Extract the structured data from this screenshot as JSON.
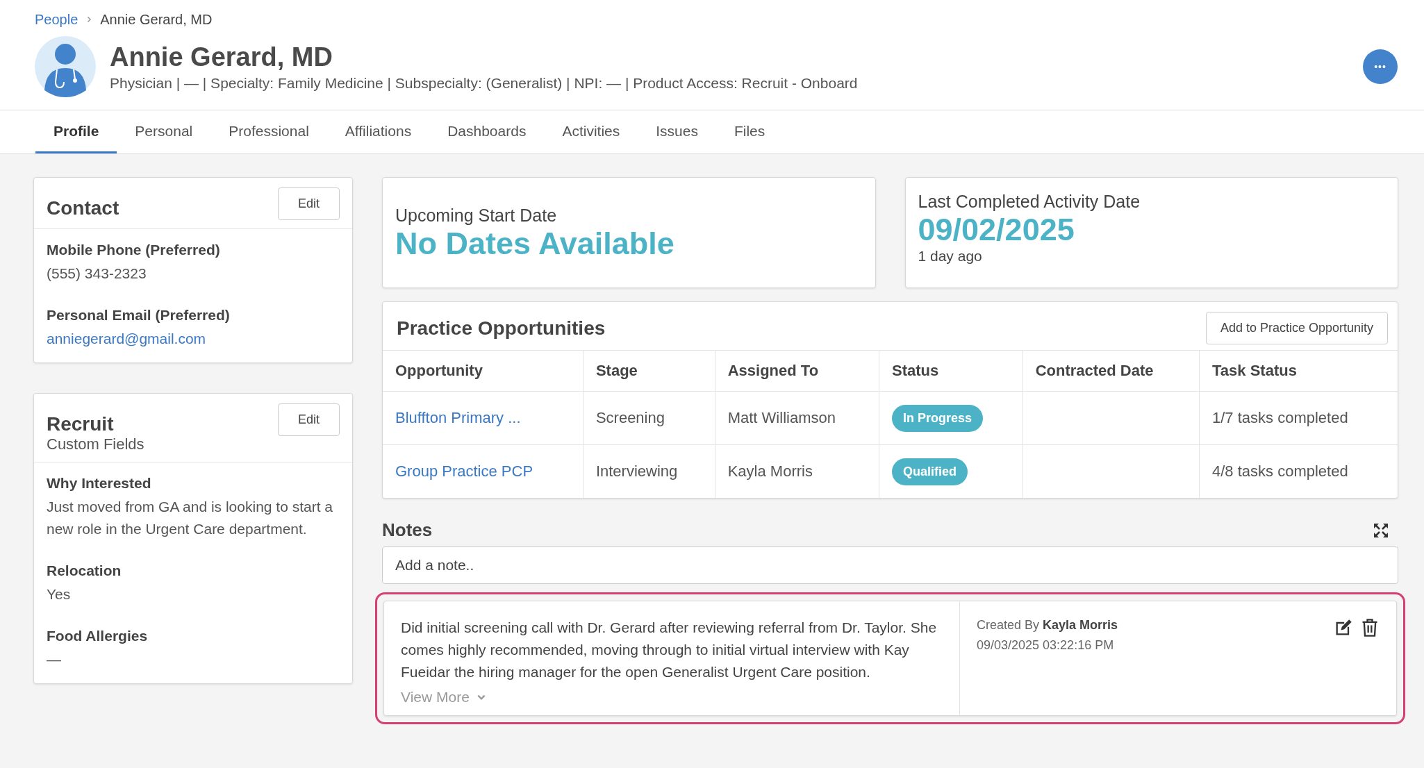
{
  "breadcrumb": {
    "parent": "People",
    "current": "Annie Gerard, MD"
  },
  "header": {
    "name": "Annie Gerard, MD",
    "subtitle": "Physician | — | Specialty: Family Medicine | Subspecialty: (Generalist) | NPI: — | Product Access: Recruit - Onboard",
    "more_button": "•••"
  },
  "tabs": [
    {
      "label": "Profile",
      "selected": true
    },
    {
      "label": "Personal",
      "selected": false
    },
    {
      "label": "Professional",
      "selected": false
    },
    {
      "label": "Affiliations",
      "selected": false
    },
    {
      "label": "Dashboards",
      "selected": false
    },
    {
      "label": "Activities",
      "selected": false
    },
    {
      "label": "Issues",
      "selected": false
    },
    {
      "label": "Files",
      "selected": false
    }
  ],
  "contact": {
    "title": "Contact",
    "edit_button": "Edit",
    "fields": [
      {
        "label": "Mobile Phone (Preferred)",
        "value": "(555) 343-2323",
        "kind": "text"
      },
      {
        "label": "Personal Email (Preferred)",
        "value": "anniegerard@gmail.com",
        "kind": "link"
      }
    ]
  },
  "recruit": {
    "title": "Recruit",
    "subtitle": "Custom Fields",
    "edit_button": "Edit",
    "fields": [
      {
        "label": "Why Interested",
        "value": "Just moved from GA and is looking to start a new role in the Urgent Care department."
      },
      {
        "label": "Relocation",
        "value": "Yes"
      },
      {
        "label": "Food Allergies",
        "value": "—"
      }
    ]
  },
  "upcoming_start": {
    "label": "Upcoming Start Date",
    "value": "No Dates Available"
  },
  "last_activity": {
    "label": "Last Completed Activity Date",
    "value": "09/02/2025",
    "relative": "1 day ago"
  },
  "practice_opportunities": {
    "title": "Practice Opportunities",
    "add_button": "Add to Practice Opportunity",
    "columns": [
      "Opportunity",
      "Stage",
      "Assigned To",
      "Status",
      "Contracted Date",
      "Task Status"
    ],
    "rows": [
      {
        "opportunity": "Bluffton Primary ...",
        "stage": "Screening",
        "assigned_to": "Matt Williamson",
        "status": "In Progress",
        "task_status": "1/7 tasks completed"
      },
      {
        "opportunity": "Group Practice PCP",
        "stage": "Interviewing",
        "assigned_to": "Kayla Morris",
        "status": "Qualified",
        "task_status": "4/8 tasks completed"
      }
    ]
  },
  "notes": {
    "title": "Notes",
    "placeholder": "Add a note..",
    "items": [
      {
        "text": "Did initial screening call with Dr. Gerard after reviewing referral from Dr. Taylor. She comes highly recommended, moving through to initial virtual interview with Kay Fueidar the hiring manager for the open Generalist Urgent Care position.",
        "view_more": "View More",
        "created_by_label": "Created By",
        "created_by": "Kayla Morris",
        "timestamp": "09/03/2025 03:22:16 PM",
        "highlighted": true
      }
    ]
  }
}
